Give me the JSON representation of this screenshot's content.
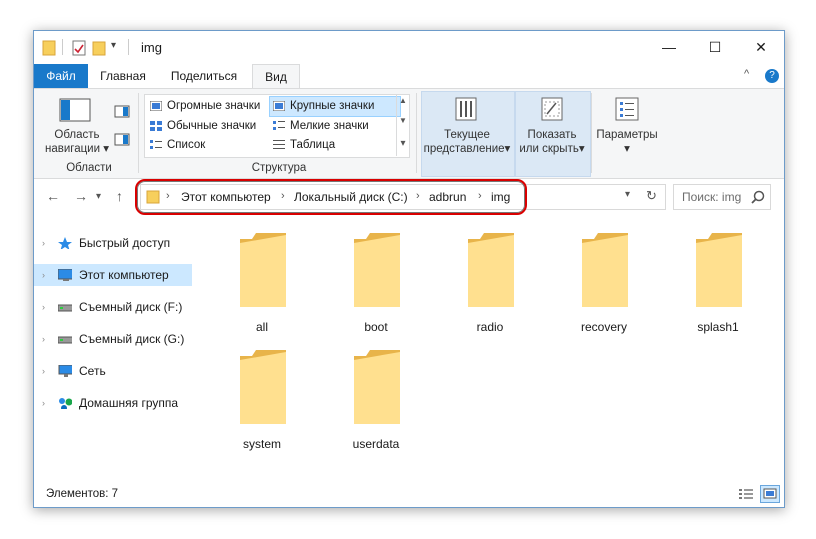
{
  "window": {
    "title": "img",
    "minimize_glyph": "—",
    "maximize_glyph": "☐",
    "close_glyph": "✕"
  },
  "tabs": [
    {
      "label": "Файл"
    },
    {
      "label": "Главная"
    },
    {
      "label": "Поделиться"
    },
    {
      "label": "Вид"
    }
  ],
  "ribbon": {
    "collapse_glyph": "^",
    "help_glyph": "?",
    "panes": {
      "label_line1": "Область",
      "label_line2": "навигации",
      "arrow": "▾",
      "group_label": "Области"
    },
    "layout": {
      "items": [
        {
          "label": "Огромные значки",
          "selected": false
        },
        {
          "label": "Крупные значки",
          "selected": true
        },
        {
          "label": "Обычные значки",
          "selected": false
        },
        {
          "label": "Мелкие значки",
          "selected": false
        },
        {
          "label": "Список",
          "selected": false
        },
        {
          "label": "Таблица",
          "selected": false
        }
      ],
      "group_label": "Структура",
      "scroll_up": "▲",
      "scroll_down": "▼",
      "scroll_more": "▾"
    },
    "current_view": {
      "line1": "Текущее",
      "line2": "представление",
      "arrow": "▾"
    },
    "show_hide": {
      "line1": "Показать",
      "line2": "или скрыть",
      "arrow": "▾"
    },
    "options": {
      "label": "Параметры",
      "arrow": "▾"
    }
  },
  "nav": {
    "back": "←",
    "forward": "→",
    "recent": "▾",
    "up": "↑",
    "dropdown": "▾",
    "refresh": "↻",
    "separator": "›"
  },
  "breadcrumb": [
    "Этот компьютер",
    "Локальный диск (C:)",
    "adbrun",
    "img"
  ],
  "search": {
    "placeholder": "Поиск: img",
    "icon": "search-icon"
  },
  "sidebar": {
    "items": [
      {
        "label": "Быстрый доступ",
        "icon": "star-icon",
        "selected": false
      },
      {
        "label": "Этот компьютер",
        "icon": "computer-icon",
        "selected": true
      },
      {
        "label": "Съемный диск (F:)",
        "icon": "drive-icon",
        "selected": false
      },
      {
        "label": "Съемный диск (G:)",
        "icon": "drive-icon",
        "selected": false
      },
      {
        "label": "Сеть",
        "icon": "network-icon",
        "selected": false
      },
      {
        "label": "Домашняя группа",
        "icon": "homegroup-icon",
        "selected": false
      }
    ],
    "arrow": "›"
  },
  "folders": [
    {
      "name": "all"
    },
    {
      "name": "boot"
    },
    {
      "name": "radio"
    },
    {
      "name": "recovery"
    },
    {
      "name": "splash1"
    },
    {
      "name": "system"
    },
    {
      "name": "userdata"
    }
  ],
  "status": {
    "text": "Элементов: 7"
  },
  "colors": {
    "accent": "#1979ca",
    "folder_front": "#ffe08f",
    "folder_back": "#e8b44a",
    "highlight": "#d90000",
    "selection": "#cce8ff"
  }
}
